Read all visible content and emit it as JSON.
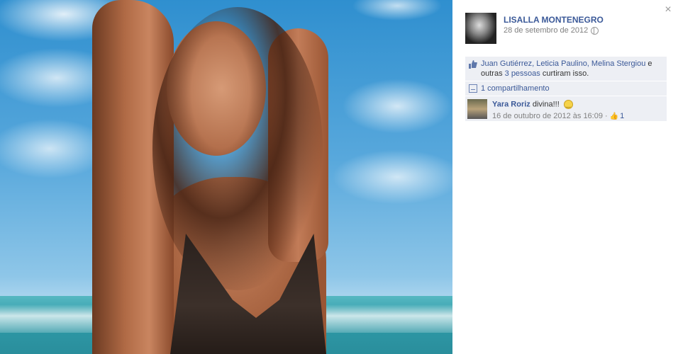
{
  "panel": {
    "close_symbol": "×",
    "author": {
      "name": "LISALLA MONTENEGRO",
      "date": "28 de setembro de 2012"
    },
    "likes": {
      "names": "Juan Gutiérrez, Leticia Paulino, Melina Stergiou",
      "connector": " e outras ",
      "others": "3 pessoas",
      "suffix": " curtiram isso."
    },
    "shares": "1 compartilhamento",
    "comment": {
      "author": "Yara Roriz",
      "text": "divina!!!",
      "date": "16 de outubro de 2012 às 16:09",
      "separator": "·",
      "like_count": "1"
    }
  },
  "icons": [
    "close-icon",
    "globe-icon",
    "like-thumb-icon",
    "share-icon",
    "smile-emoticon-icon"
  ]
}
